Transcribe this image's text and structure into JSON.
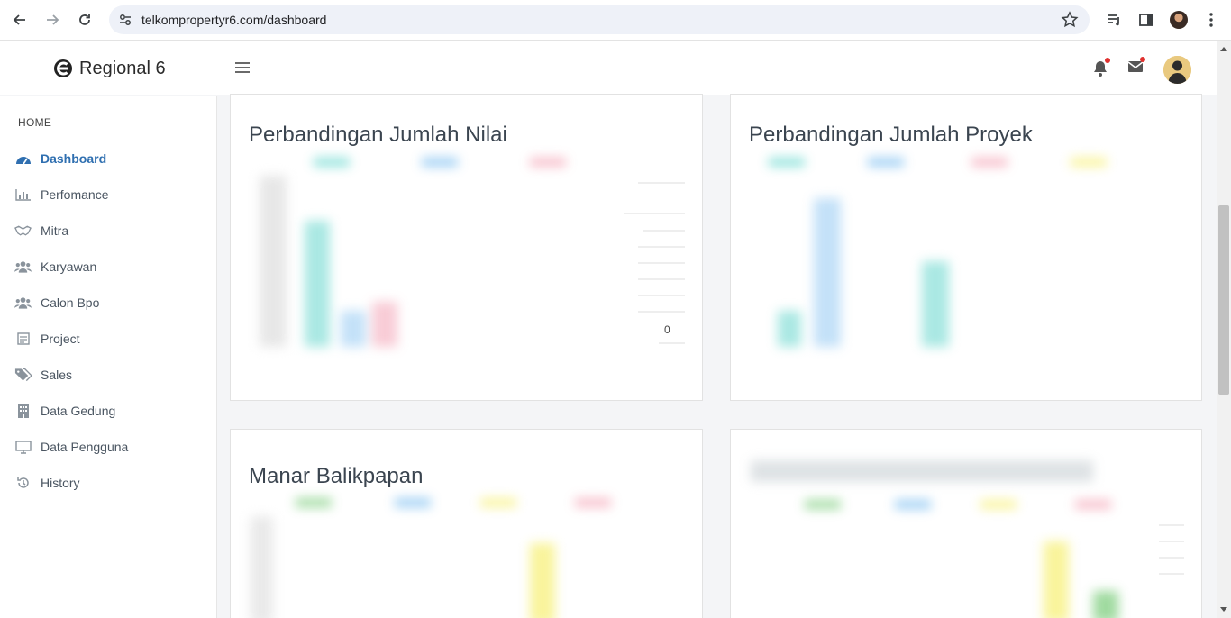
{
  "browser": {
    "url": "telkompropertyr6.com/dashboard"
  },
  "header": {
    "brand_title": "Regional 6"
  },
  "sidebar": {
    "heading": "HOME",
    "items": [
      {
        "label": "Dashboard",
        "icon": "gauge-icon"
      },
      {
        "label": "Perfomance",
        "icon": "bar-chart-icon"
      },
      {
        "label": "Mitra",
        "icon": "handshake-icon"
      },
      {
        "label": "Karyawan",
        "icon": "users-icon"
      },
      {
        "label": "Calon Bpo",
        "icon": "users-icon"
      },
      {
        "label": "Project",
        "icon": "document-icon"
      },
      {
        "label": "Sales",
        "icon": "tags-icon"
      },
      {
        "label": "Data Gedung",
        "icon": "building-icon"
      },
      {
        "label": "Data Pengguna",
        "icon": "monitor-icon"
      },
      {
        "label": "History",
        "icon": "history-icon"
      }
    ]
  },
  "cards": [
    {
      "title": "Perbandingan Jumlah Nilai",
      "right_tick": "0"
    },
    {
      "title": "Perbandingan Jumlah Proyek"
    },
    {
      "title": "Manar Balikpapan"
    },
    {
      "title": ""
    }
  ],
  "colors": {
    "active": "#2f6fb0",
    "teal": "#7fded6",
    "blue": "#8ec7f2",
    "pink": "#f6b3c1",
    "yellow": "#f8f28a",
    "green": "#8fd48f"
  }
}
